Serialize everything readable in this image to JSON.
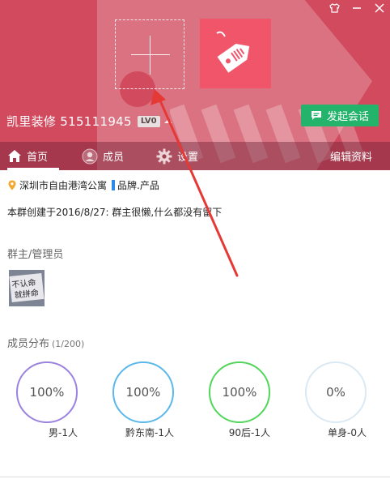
{
  "header": {
    "group_name": "凯里装修 515111945",
    "level_badge": "LV0",
    "start_chat_label": "发起会话",
    "bg_color": "#d14a5e",
    "accent_green": "#24b36b"
  },
  "window_controls": {
    "icons": [
      "shirt-icon",
      "minimize-icon",
      "close-icon"
    ]
  },
  "nav": {
    "home": "首页",
    "members": "成员",
    "settings": "设置",
    "edit_profile": "编辑资料"
  },
  "info": {
    "location": "深圳市自由港湾公寓",
    "category": "品牌.产品",
    "description": "本群创建于2016/8/27:  群主很懒,什么都没有留下"
  },
  "admins": {
    "title": "群主/管理员",
    "avatar_text": "不认命 就拼命"
  },
  "distribution": {
    "title": "成员分布",
    "count": "(1/200)",
    "items": [
      {
        "percent": "100%",
        "label": "男-1人",
        "color": "#9b82e0"
      },
      {
        "percent": "100%",
        "label": "黔东南-1人",
        "color": "#5bb8ea"
      },
      {
        "percent": "100%",
        "label": "90后-1人",
        "color": "#52d65a"
      },
      {
        "percent": "0%",
        "label": "单身-0人",
        "color": "#dbe9f3"
      }
    ]
  }
}
